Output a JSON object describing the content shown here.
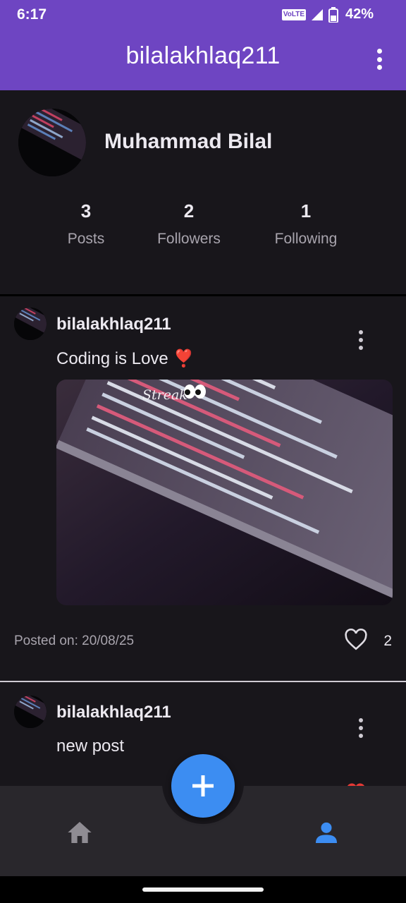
{
  "status": {
    "time": "6:17",
    "network_badge": "VoLTE",
    "battery": "42%"
  },
  "appbar": {
    "title": "bilalakhlaq211",
    "menu_icon": "more-vert-icon"
  },
  "profile": {
    "name": "Muhammad Bilal",
    "stats": [
      {
        "value": "3",
        "label": "Posts"
      },
      {
        "value": "2",
        "label": "Followers"
      },
      {
        "value": "1",
        "label": "Following"
      }
    ]
  },
  "posts": [
    {
      "username": "bilalakhlaq211",
      "text": "Coding is Love ",
      "emoji": "❣️",
      "image_overlay_text": "Streak",
      "date": "Posted on: 20/08/25",
      "likes": "2"
    },
    {
      "username": "bilalakhlaq211",
      "text": "new post"
    }
  ],
  "bottom_nav": {
    "items": [
      {
        "icon": "home-icon",
        "active": false
      },
      {
        "icon": "person-icon",
        "active": true
      }
    ],
    "fab_icon": "plus-icon"
  },
  "colors": {
    "appbar": "#6e45c2",
    "background": "#18161b",
    "nav_bar": "#29272c",
    "accent": "#3c8df2",
    "inactive_icon": "#8f8c93"
  }
}
